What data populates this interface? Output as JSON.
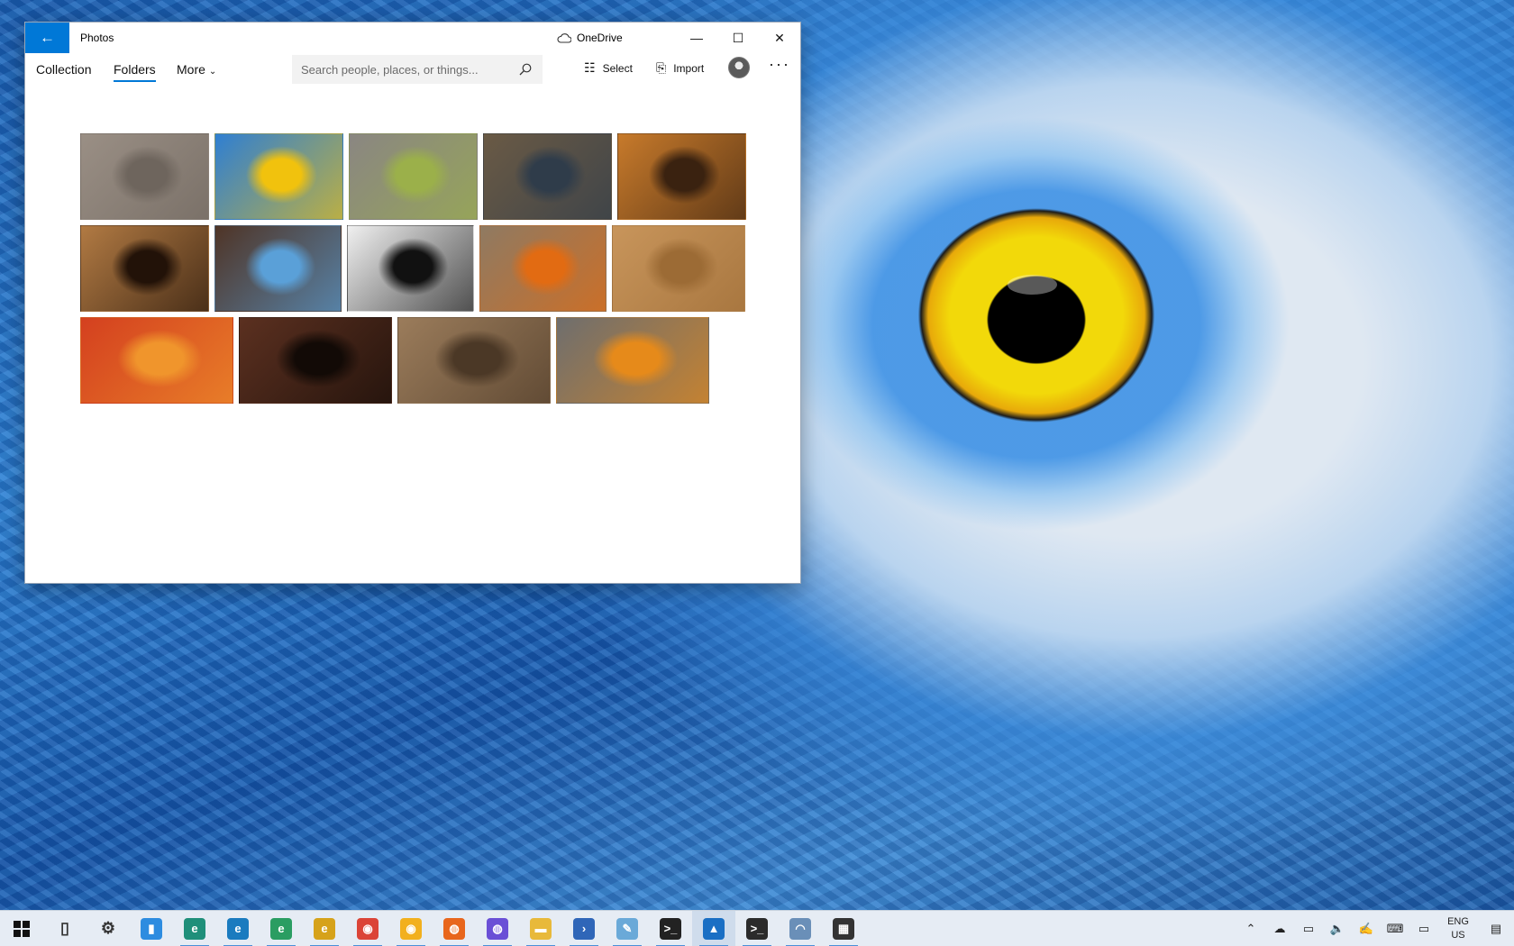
{
  "window": {
    "back_icon": "←",
    "title": "Photos",
    "onedrive_label": "OneDrive",
    "minimize_icon": "—",
    "maximize_icon": "☐",
    "close_icon": "✕"
  },
  "nav": {
    "tabs": [
      {
        "label": "Collection"
      },
      {
        "label": "Folders"
      },
      {
        "label": "More"
      }
    ],
    "active_tab": "Folders"
  },
  "search": {
    "placeholder": "Search people, places, or things..."
  },
  "commands": {
    "select_label": "Select",
    "import_label": "Import",
    "overflow": "···"
  },
  "gallery": {
    "rows": [
      [
        {
          "subject": "elephant eye",
          "colors": [
            "#9a8f85",
            "#6e655d"
          ]
        },
        {
          "subject": "blue parrot eye",
          "colors": [
            "#2f7fd2",
            "#f1c20d"
          ]
        },
        {
          "subject": "cat eye",
          "colors": [
            "#8a8682",
            "#9bb04a"
          ]
        },
        {
          "subject": "bird of prey eye",
          "colors": [
            "#6a5a45",
            "#2f3c4a"
          ]
        },
        {
          "subject": "tiger eye",
          "colors": [
            "#c77a2b",
            "#3a2210"
          ]
        }
      ],
      [
        {
          "subject": "dog eye",
          "colors": [
            "#b17a43",
            "#221208"
          ]
        },
        {
          "subject": "husky eye",
          "colors": [
            "#4f3426",
            "#5aa0d8"
          ]
        },
        {
          "subject": "zebra eye",
          "colors": [
            "#f0f0f0",
            "#111111"
          ]
        },
        {
          "subject": "owl eyes",
          "colors": [
            "#8f7a62",
            "#e26b12"
          ]
        },
        {
          "subject": "lion eye",
          "colors": [
            "#c8955b",
            "#9c6b35"
          ]
        }
      ],
      [
        {
          "subject": "rooster eye",
          "colors": [
            "#d4401f",
            "#f0952c"
          ]
        },
        {
          "subject": "horse eye",
          "colors": [
            "#5b3020",
            "#120a06"
          ]
        },
        {
          "subject": "giraffe eye",
          "colors": [
            "#9b7c5b",
            "#4b3826"
          ]
        },
        {
          "subject": "snowy owl eye",
          "colors": [
            "#6e6e6e",
            "#e68a1a"
          ]
        }
      ]
    ]
  },
  "taskbar": {
    "apps": [
      {
        "name": "start",
        "glyph": "",
        "color": "#111111"
      },
      {
        "name": "task-view",
        "glyph": "▯",
        "color": "#333333"
      },
      {
        "name": "settings",
        "glyph": "⚙",
        "color": "#333333"
      },
      {
        "name": "phone",
        "glyph": "▮",
        "color": "#2d8ce0"
      },
      {
        "name": "edge",
        "glyph": "e",
        "color": "#1f8f7a"
      },
      {
        "name": "edge-beta",
        "glyph": "e",
        "color": "#1a7bbf"
      },
      {
        "name": "edge-dev",
        "glyph": "e",
        "color": "#2a9d62"
      },
      {
        "name": "edge-canary",
        "glyph": "e",
        "color": "#d6a21a"
      },
      {
        "name": "chrome",
        "glyph": "◉",
        "color": "#db4437"
      },
      {
        "name": "chrome-canary",
        "glyph": "◉",
        "color": "#f2b01e"
      },
      {
        "name": "firefox",
        "glyph": "◍",
        "color": "#e8661c"
      },
      {
        "name": "firefox-nightly",
        "glyph": "◍",
        "color": "#6a4fd6"
      },
      {
        "name": "file-explorer",
        "glyph": "▬",
        "color": "#e8b93a"
      },
      {
        "name": "powershell",
        "glyph": "›",
        "color": "#2f66b8"
      },
      {
        "name": "notepad",
        "glyph": "✎",
        "color": "#6aa9d8"
      },
      {
        "name": "terminal",
        "glyph": ">_",
        "color": "#222222"
      },
      {
        "name": "photos",
        "glyph": "▲",
        "color": "#1a6fc4"
      },
      {
        "name": "windows-terminal",
        "glyph": ">_",
        "color": "#2b2b2b"
      },
      {
        "name": "network-drive",
        "glyph": "◠",
        "color": "#6a8fb8"
      },
      {
        "name": "store",
        "glyph": "▦",
        "color": "#333333"
      }
    ],
    "running": [
      "edge",
      "edge-beta",
      "edge-dev",
      "edge-canary",
      "chrome",
      "chrome-canary",
      "firefox",
      "firefox-nightly",
      "file-explorer",
      "powershell",
      "notepad",
      "terminal",
      "photos",
      "windows-terminal",
      "network-drive",
      "store"
    ],
    "active": "photos",
    "tray": {
      "chevron": "⌃",
      "onedrive": "☁",
      "network": "▭",
      "volume": "🔈",
      "pen": "✍",
      "keyboard": "⌨",
      "tablet": "▭",
      "lang_top": "ENG",
      "lang_bottom": "US",
      "notifications": "▤"
    }
  }
}
